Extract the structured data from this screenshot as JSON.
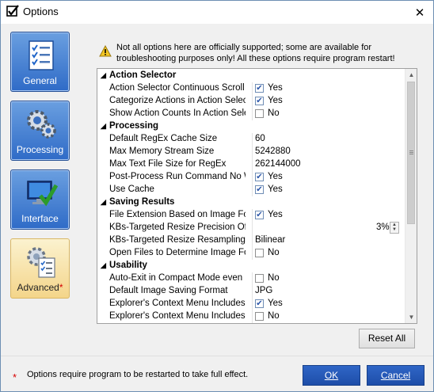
{
  "window": {
    "title": "Options",
    "close_glyph": "✕"
  },
  "nav": [
    {
      "label": "General",
      "icon": "checklist-icon"
    },
    {
      "label": "Processing",
      "icon": "gears-icon"
    },
    {
      "label": "Interface",
      "icon": "monitor-check-icon"
    },
    {
      "label": "Advanced",
      "icon": "advanced-gears-icon",
      "star": "*",
      "active": true
    }
  ],
  "warning": {
    "text": "Not all options here are officially supported; some are available for troubleshooting purposes only! All these options require program restart!"
  },
  "grid": {
    "categories": [
      {
        "name": "Action Selector",
        "tri": "◢"
      },
      {
        "name": "Processing",
        "tri": "◢"
      },
      {
        "name": "Saving Results",
        "tri": "◢"
      },
      {
        "name": "Usability",
        "tri": "◢"
      }
    ],
    "rows": [
      {
        "label": "Action Selector Continuous Scroll",
        "value": "Yes"
      },
      {
        "label": "Categorize Actions in Action Selecto",
        "value": "Yes"
      },
      {
        "label": "Show Action Counts In Action Select",
        "value": "No"
      },
      {
        "label": "Default RegEx Cache Size",
        "value": "60"
      },
      {
        "label": "Max Memory Stream Size",
        "value": "5242880"
      },
      {
        "label": "Max Text File Size for RegEx",
        "value": "262144000"
      },
      {
        "label": "Post-Process Run Command No Wi",
        "value": "Yes"
      },
      {
        "label": "Use Cache",
        "value": "Yes"
      },
      {
        "label": "File Extension Based on Image For",
        "value": "Yes"
      },
      {
        "label": "KBs-Targeted Resize Precision Offs",
        "value": "3%"
      },
      {
        "label": "KBs-Targeted Resize Resampling M",
        "value": "Bilinear"
      },
      {
        "label": "Open Files to Determine Image For",
        "value": "No"
      },
      {
        "label": "Auto-Exit in Compact Mode even if",
        "value": "No"
      },
      {
        "label": "Default Image Saving Format",
        "value": "JPG"
      },
      {
        "label": "Explorer's Context Menu Includes F",
        "value": "Yes"
      },
      {
        "label": "Explorer's Context Menu Includes F",
        "value": "No"
      }
    ]
  },
  "buttons": {
    "reset": "Reset All",
    "ok": "OK",
    "cancel": "Cancel"
  },
  "footer": {
    "star": "*",
    "note": "Options require program to be restarted to take full effect."
  },
  "colors": {
    "accent": "#2f66c7",
    "required": "#d60000"
  }
}
